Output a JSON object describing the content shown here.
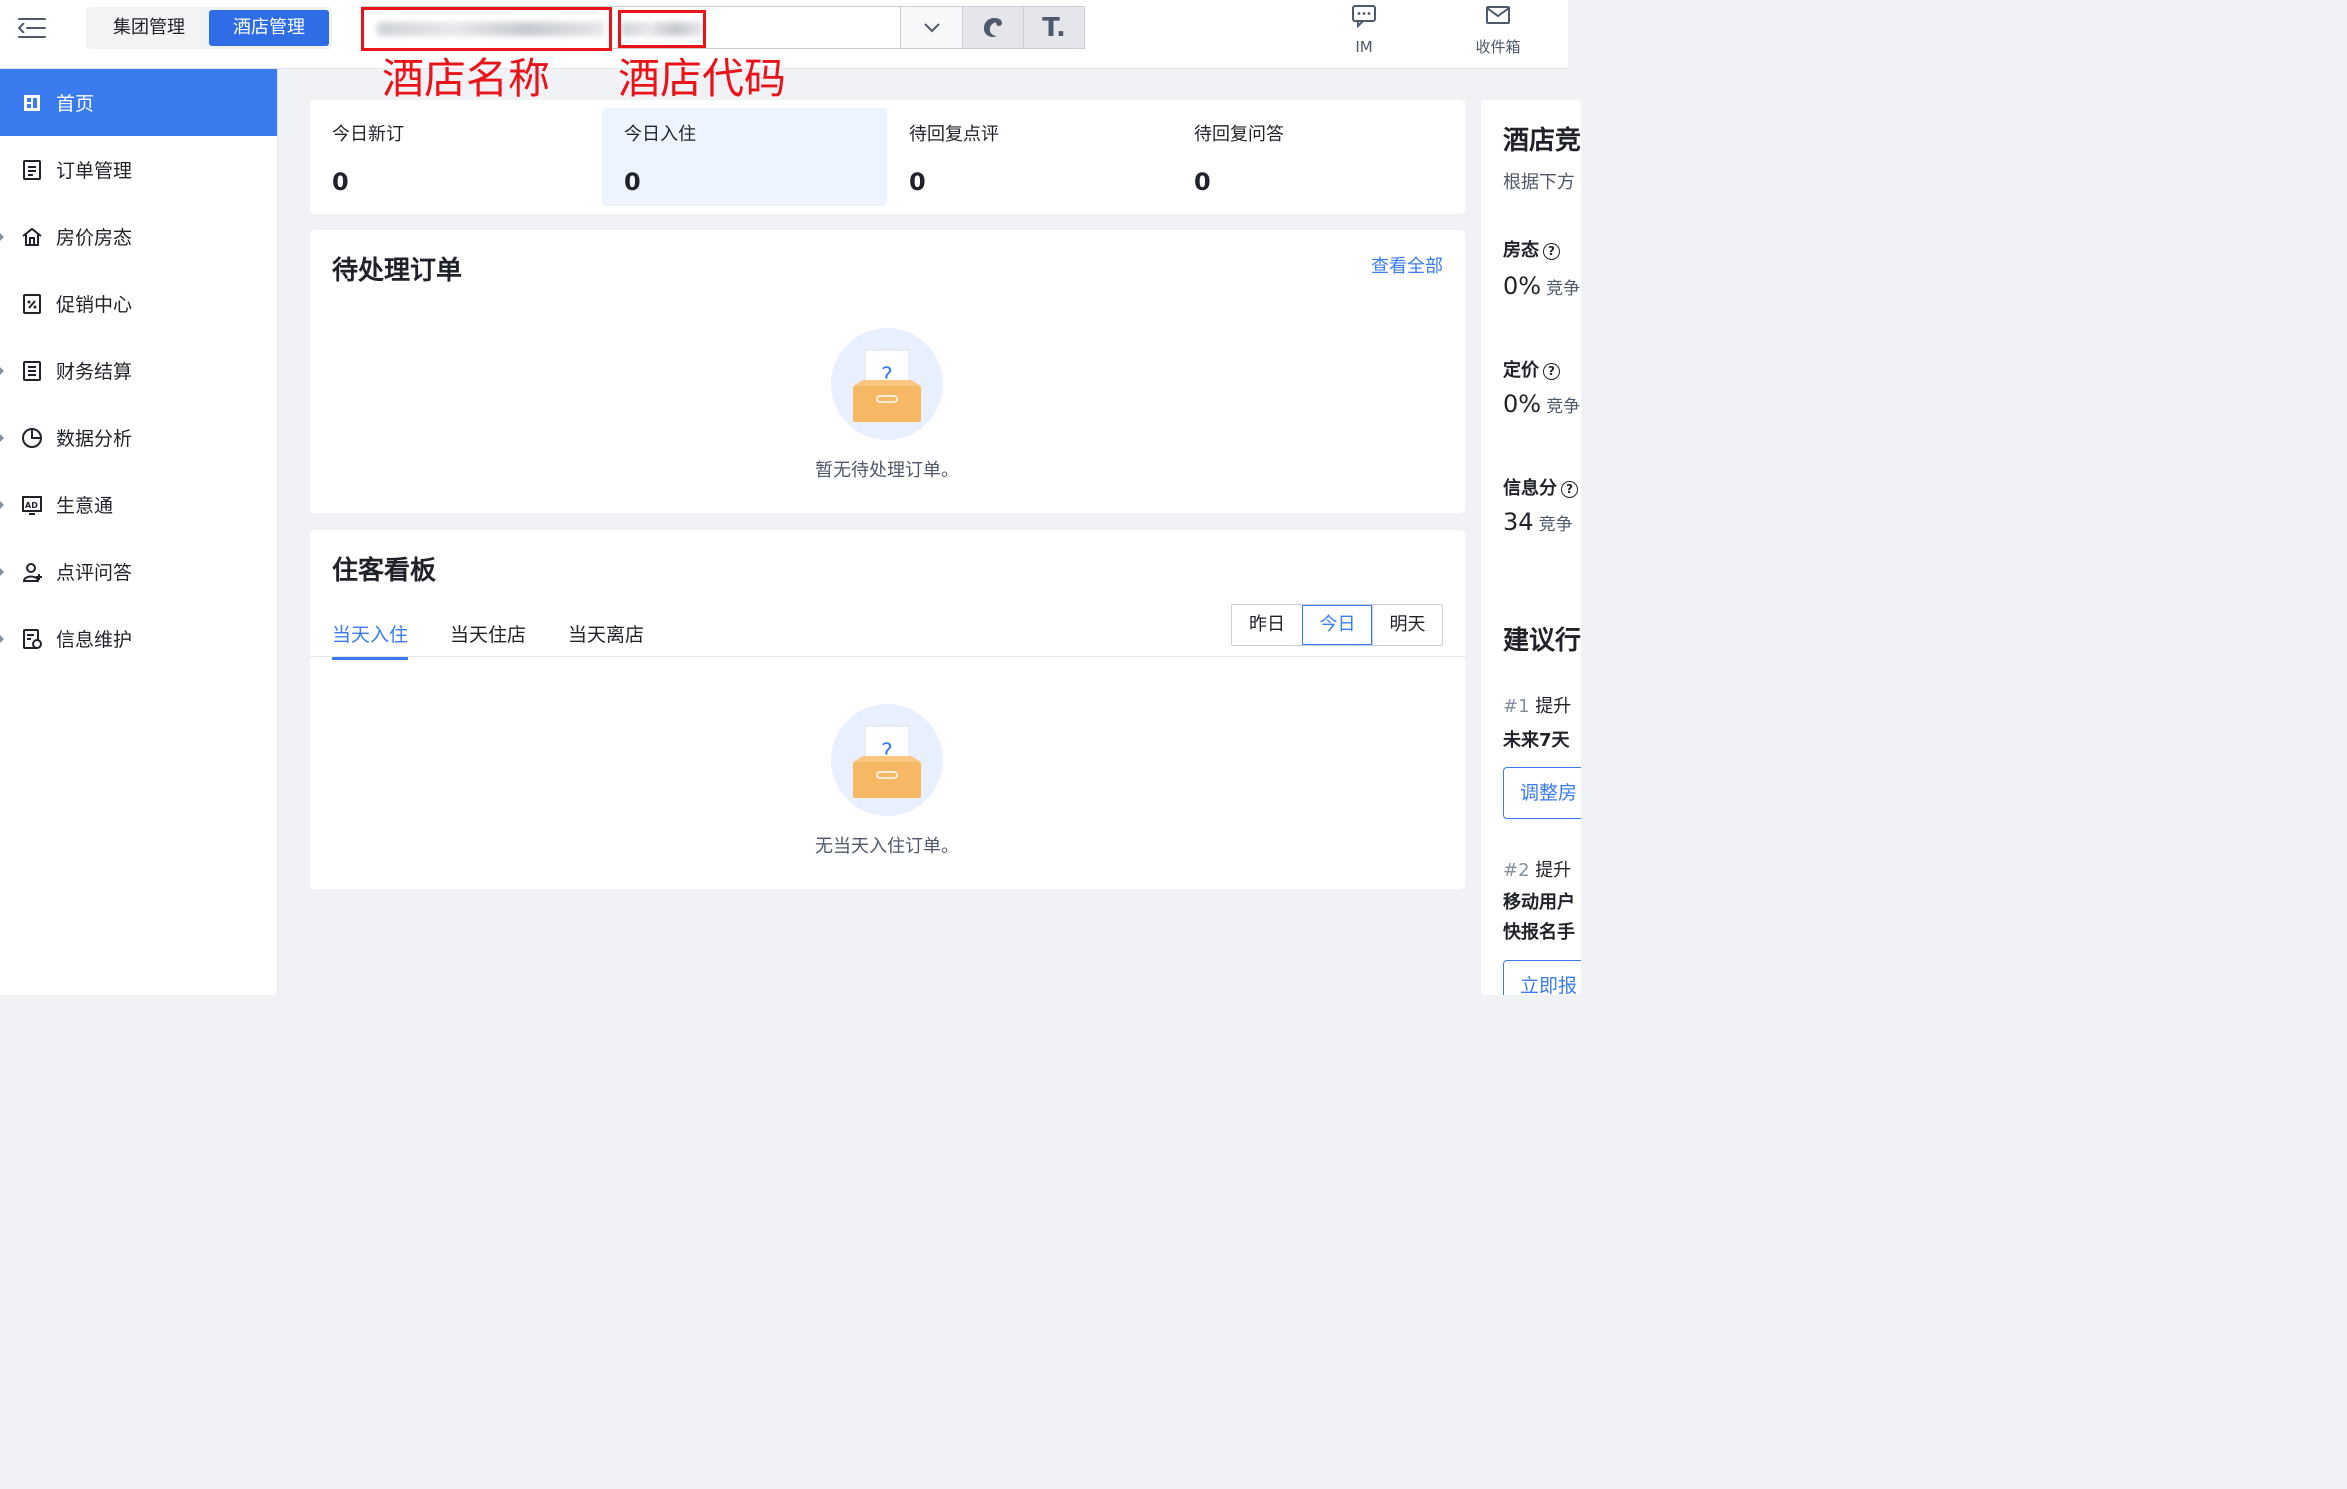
{
  "topbar": {
    "segments": [
      {
        "label": "集团管理",
        "active": false
      },
      {
        "label": "酒店管理",
        "active": true
      }
    ],
    "hotel_select": {
      "name_blurred": true,
      "code_blurred": true
    },
    "actions": [
      {
        "label": "IM",
        "icon": "chat-icon"
      },
      {
        "label": "收件箱",
        "icon": "mail-icon"
      }
    ]
  },
  "annotations": {
    "hotel_name": "酒店名称",
    "hotel_code": "酒店代码",
    "color": "#e8141a"
  },
  "sidebar": {
    "items": [
      {
        "label": "首页",
        "icon": "home-icon",
        "active": true
      },
      {
        "label": "订单管理",
        "icon": "order-icon"
      },
      {
        "label": "房价房态",
        "icon": "house-icon"
      },
      {
        "label": "促销中心",
        "icon": "promotion-icon"
      },
      {
        "label": "财务结算",
        "icon": "finance-icon"
      },
      {
        "label": "数据分析",
        "icon": "pie-chart-icon"
      },
      {
        "label": "生意通",
        "icon": "ad-icon"
      },
      {
        "label": "点评问答",
        "icon": "review-icon"
      },
      {
        "label": "信息维护",
        "icon": "info-edit-icon"
      }
    ]
  },
  "stats": [
    {
      "label": "今日新订",
      "value": "0"
    },
    {
      "label": "今日入住",
      "value": "0"
    },
    {
      "label": "待回复点评",
      "value": "0"
    },
    {
      "label": "待回复问答",
      "value": "0"
    }
  ],
  "pending_orders": {
    "title": "待处理订单",
    "view_all": "查看全部",
    "empty_text": "暂无待处理订单。"
  },
  "guest_board": {
    "title": "住客看板",
    "tabs": [
      "当天入住",
      "当天住店",
      "当天离店"
    ],
    "days": [
      "昨日",
      "今日",
      "明天"
    ],
    "active_day": "今日",
    "empty_text": "无当天入住订单。"
  },
  "right_panel": {
    "title": "酒店竞",
    "subtitle": "根据下方",
    "metrics": [
      {
        "label": "房态",
        "value": "0%",
        "suffix": "竞争"
      },
      {
        "label": "定价",
        "value": "0%",
        "suffix": "竞争"
      },
      {
        "label": "信息分",
        "value": "34",
        "suffix": "竞争"
      }
    ],
    "suggest_title": "建议行",
    "suggestions": [
      {
        "rank": "#1",
        "title": "提升",
        "desc": "未来7天",
        "button": "调整房"
      },
      {
        "rank": "#2",
        "title": "提升",
        "desc": "移动用户",
        "desc2": "快报名手",
        "button": "立即报"
      }
    ]
  },
  "colors": {
    "primary": "#3a7cf0",
    "accent_blue": "#2f6de6",
    "highlight_bg": "#edf4ff"
  }
}
